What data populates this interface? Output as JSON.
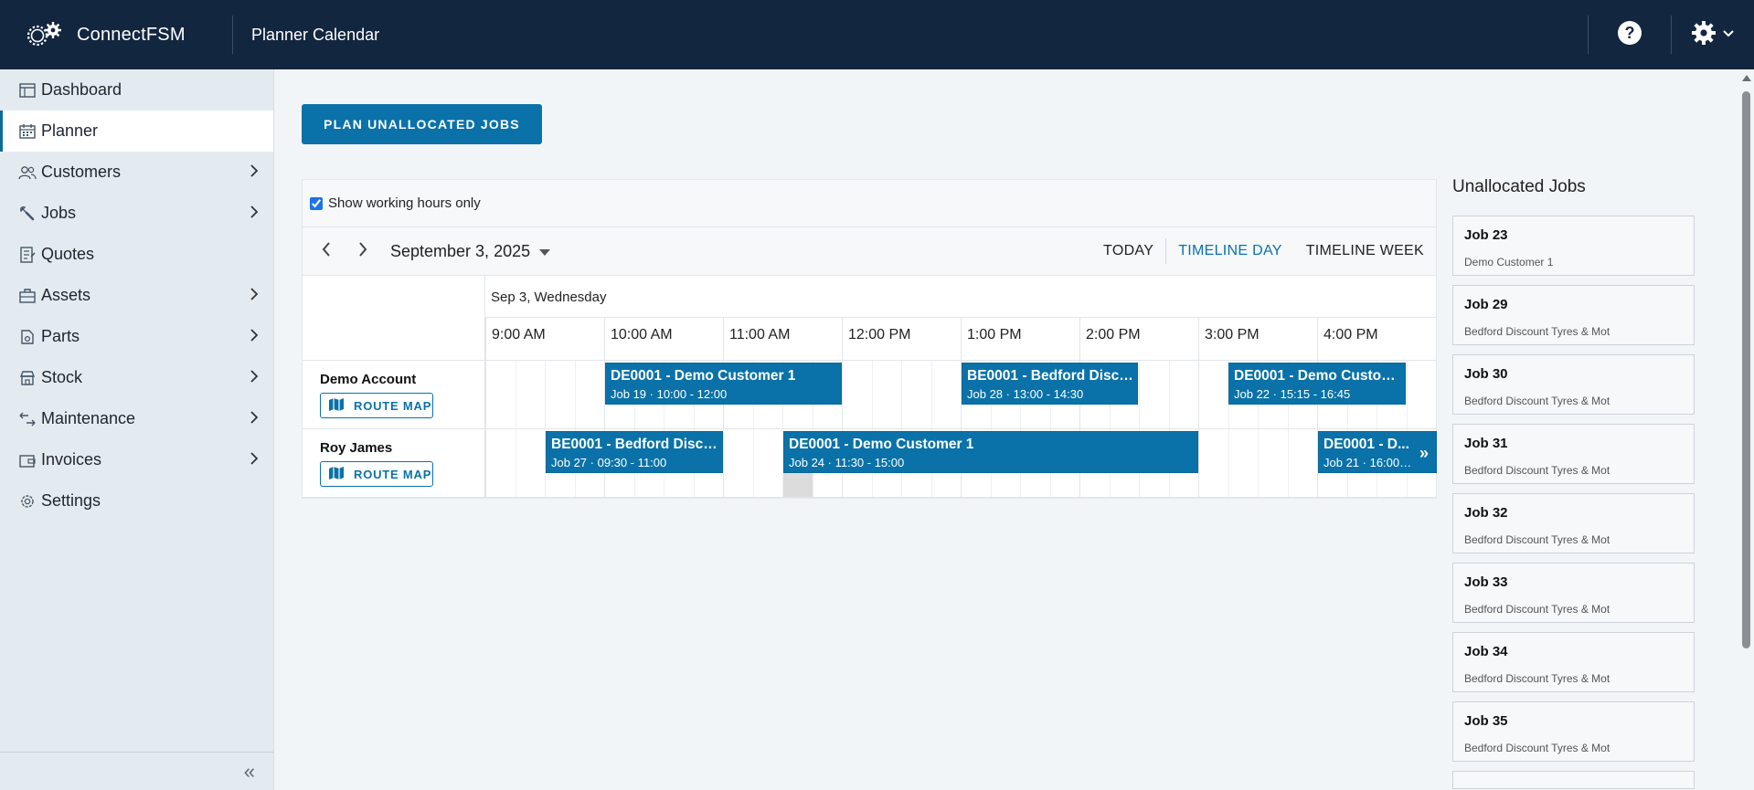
{
  "header": {
    "brand": "ConnectFSM",
    "page_title": "Planner Calendar",
    "icons": [
      "gear-cluster-logo-icon",
      "help-icon",
      "settings-gear-icon",
      "chevron-down-icon"
    ]
  },
  "sidebar": {
    "items": [
      {
        "label": "Dashboard",
        "icon": "dashboard-icon",
        "has_children": false
      },
      {
        "label": "Planner",
        "icon": "calendar-icon",
        "has_children": false,
        "active": true
      },
      {
        "label": "Customers",
        "icon": "users-icon",
        "has_children": true
      },
      {
        "label": "Jobs",
        "icon": "wrench-icon",
        "has_children": true
      },
      {
        "label": "Quotes",
        "icon": "quote-doc-icon",
        "has_children": false
      },
      {
        "label": "Assets",
        "icon": "briefcase-icon",
        "has_children": true
      },
      {
        "label": "Parts",
        "icon": "parts-icon",
        "has_children": true
      },
      {
        "label": "Stock",
        "icon": "store-icon",
        "has_children": true
      },
      {
        "label": "Maintenance",
        "icon": "maintenance-icon",
        "has_children": true
      },
      {
        "label": "Invoices",
        "icon": "wallet-icon",
        "has_children": true
      },
      {
        "label": "Settings",
        "icon": "settings-icon",
        "has_children": false
      }
    ],
    "collapse_glyph": "«"
  },
  "main": {
    "plan_button": "PLAN UNALLOCATED JOBS",
    "working_hours_label": "Show working hours only",
    "working_hours_checked": true,
    "date_label": "September 3, 2025",
    "views": [
      "TODAY",
      "TIMELINE DAY",
      "TIMELINE WEEK"
    ],
    "active_view": "TIMELINE DAY",
    "day_header": "Sep 3, Wednesday",
    "hours": [
      "9:00 AM",
      "10:00 AM",
      "11:00 AM",
      "12:00 PM",
      "1:00 PM",
      "2:00 PM",
      "3:00 PM",
      "4:00 PM"
    ],
    "route_map_label": "ROUTE MAP",
    "resources": [
      {
        "name": "Demo Account",
        "events": [
          {
            "title": "DE0001 - Demo Customer 1",
            "sub": "Job 19 · 10:00 - 12:00"
          },
          {
            "title": "BE0001 - Bedford Disco...",
            "sub": "Job 28 · 13:00 - 14:30"
          },
          {
            "title": "DE0001 - Demo Custom...",
            "sub": "Job 22 · 15:15 - 16:45"
          }
        ]
      },
      {
        "name": "Roy James",
        "events": [
          {
            "title": "BE0001 - Bedford Disco...",
            "sub": "Job 27 · 09:30 - 11:00"
          },
          {
            "title": "DE0001 - Demo Customer 1",
            "sub": "Job 24 · 11:30 - 15:00"
          },
          {
            "title": "DE0001 - D...",
            "sub": "Job 21 · 16:00 ...",
            "more": "»"
          }
        ]
      }
    ]
  },
  "unallocated": {
    "title": "Unallocated Jobs",
    "jobs": [
      {
        "title": "Job 23",
        "customer": "Demo Customer 1"
      },
      {
        "title": "Job 29",
        "customer": "Bedford Discount Tyres & Mot"
      },
      {
        "title": "Job 30",
        "customer": "Bedford Discount Tyres & Mot"
      },
      {
        "title": "Job 31",
        "customer": "Bedford Discount Tyres & Mot"
      },
      {
        "title": "Job 32",
        "customer": "Bedford Discount Tyres & Mot"
      },
      {
        "title": "Job 33",
        "customer": "Bedford Discount Tyres & Mot"
      },
      {
        "title": "Job 34",
        "customer": "Bedford Discount Tyres & Mot"
      },
      {
        "title": "Job 35",
        "customer": "Bedford Discount Tyres & Mot"
      }
    ]
  },
  "colors": {
    "header_bg": "#132640",
    "accent": "#0a72a8",
    "sidebar_bg": "#e4ebf0"
  }
}
